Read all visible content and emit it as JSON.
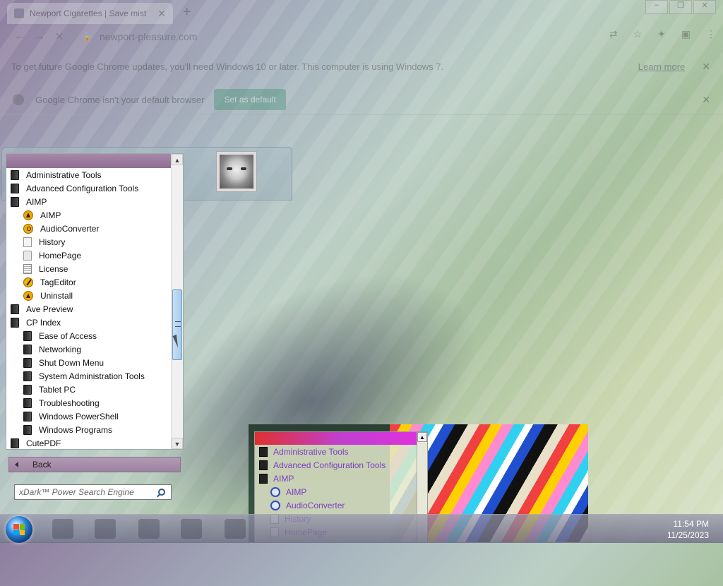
{
  "browser": {
    "tab_title": "Newport Cigarettes | Save mist",
    "url": "newport-pleasure.com",
    "update_notice": "To get future Google Chrome updates, you'll need Windows 10 or later. This computer is using Windows 7.",
    "learn_more": "Learn more",
    "default_notice": "Google Chrome isn't your default browser",
    "set_default": "Set as default",
    "new_tab": "+",
    "close": "✕"
  },
  "start_menu": {
    "programs": [
      {
        "label": "Administrative Tools",
        "level": 0,
        "icon": "folder-icon"
      },
      {
        "label": "Advanced Configuration Tools",
        "level": 0,
        "icon": "folder-icon"
      },
      {
        "label": "AIMP",
        "level": 0,
        "icon": "folder-icon"
      },
      {
        "label": "AIMP",
        "level": 1,
        "icon": "aimp-icon"
      },
      {
        "label": "AudioConverter",
        "level": 1,
        "icon": "audio-converter-icon"
      },
      {
        "label": "History",
        "level": 1,
        "icon": "document-icon"
      },
      {
        "label": "HomePage",
        "level": 1,
        "icon": "homepage-icon"
      },
      {
        "label": "License",
        "level": 1,
        "icon": "license-icon"
      },
      {
        "label": "TagEditor",
        "level": 1,
        "icon": "tag-editor-icon"
      },
      {
        "label": "Uninstall",
        "level": 1,
        "icon": "uninstall-icon"
      },
      {
        "label": "Ave Preview",
        "level": 0,
        "icon": "folder-icon"
      },
      {
        "label": "CP Index",
        "level": 0,
        "icon": "folder-icon"
      },
      {
        "label": "Ease of Access",
        "level": 1,
        "icon": "folder-icon"
      },
      {
        "label": "Networking",
        "level": 1,
        "icon": "folder-icon"
      },
      {
        "label": "Shut Down Menu",
        "level": 1,
        "icon": "folder-icon"
      },
      {
        "label": "System Administration Tools",
        "level": 1,
        "icon": "folder-icon"
      },
      {
        "label": "Tablet PC",
        "level": 1,
        "icon": "folder-icon"
      },
      {
        "label": "Troubleshooting",
        "level": 1,
        "icon": "folder-icon"
      },
      {
        "label": "Windows PowerShell",
        "level": 1,
        "icon": "folder-icon"
      },
      {
        "label": "Windows Programs",
        "level": 1,
        "icon": "folder-icon"
      },
      {
        "label": "CutePDF",
        "level": 0,
        "icon": "folder-icon"
      }
    ],
    "back_label": "Back",
    "search_placeholder": "xDark™ Power Search Engine"
  },
  "glitch_menu": {
    "items": [
      {
        "label": "Administrative Tools",
        "level": 0
      },
      {
        "label": "Advanced Configuration Tools",
        "level": 0
      },
      {
        "label": "AIMP",
        "level": 0
      },
      {
        "label": "AIMP",
        "level": 1
      },
      {
        "label": "AudioConverter",
        "level": 1
      },
      {
        "label": "History",
        "level": 1
      },
      {
        "label": "HomePage",
        "level": 1
      }
    ]
  },
  "taskbar": {
    "time": "11:54 PM",
    "date": "11/25/2023"
  },
  "colors": {
    "flag_red": "#f25022",
    "flag_green": "#7fba00",
    "flag_blue": "#00a4ef",
    "flag_yellow": "#ffb900"
  }
}
